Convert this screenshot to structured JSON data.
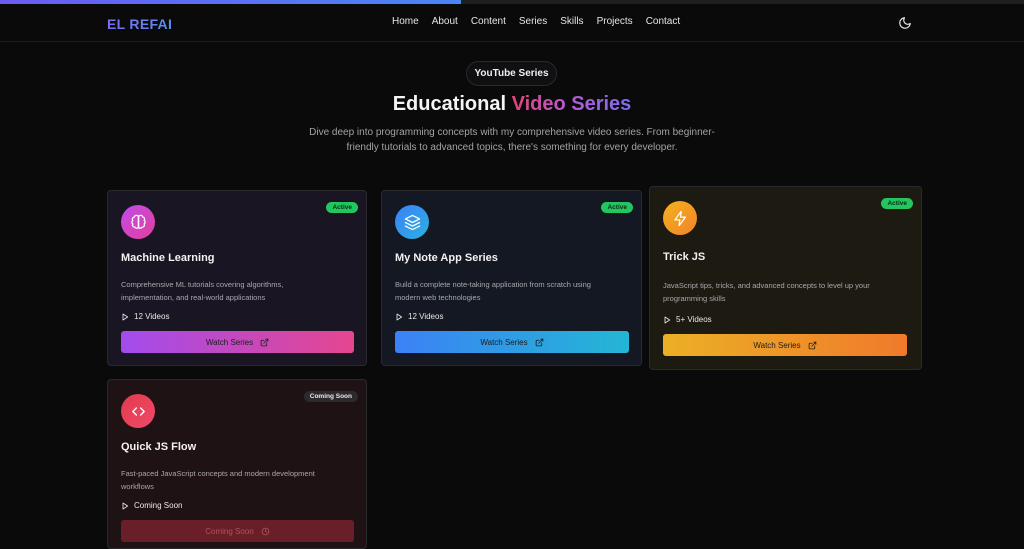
{
  "header": {
    "logo": "EL REFAI",
    "nav": [
      "Home",
      "About",
      "Content",
      "Series",
      "Skills",
      "Projects",
      "Contact"
    ],
    "theme_toggle_icon": "moon-icon",
    "scroll_progress": 0.45
  },
  "hero": {
    "pill": "YouTube Series",
    "title_main": "Educational",
    "title_accent": "Video Series",
    "subtitle": "Dive deep into programming concepts with my comprehensive video series. From beginner-friendly tutorials to advanced topics, there's something for every developer."
  },
  "cards": [
    {
      "icon": "brain-icon",
      "badge": "Active",
      "title": "Machine Learning",
      "description": "Comprehensive ML tutorials covering algorithms, implementation, and real-world applications",
      "count": "12 Videos",
      "button": "Watch Series",
      "button_icon": "external-link-icon"
    },
    {
      "icon": "layers-icon",
      "badge": "Active",
      "title": "My Note App Series",
      "description": "Build a complete note-taking application from scratch using modern web technologies",
      "count": "12 Videos",
      "button": "Watch Series",
      "button_icon": "external-link-icon"
    },
    {
      "icon": "lightning-icon",
      "badge": "Active",
      "title": "Trick JS",
      "description": "JavaScript tips, tricks, and advanced concepts to level up your programming skills",
      "count": "5+ Videos",
      "button": "Watch Series",
      "button_icon": "external-link-icon"
    },
    {
      "icon": "code-icon",
      "badge": "Coming Soon",
      "title": "Quick JS Flow",
      "description": "Fast-paced JavaScript concepts and modern development workflows",
      "count": "Coming Soon",
      "button": "Coming Soon",
      "button_icon": "clock-icon"
    }
  ],
  "colors": {
    "background": "#0a0a0b",
    "active_badge": "#22c55e",
    "logo_gradient": [
      "#7c6cf4",
      "#5b8ef6"
    ]
  }
}
